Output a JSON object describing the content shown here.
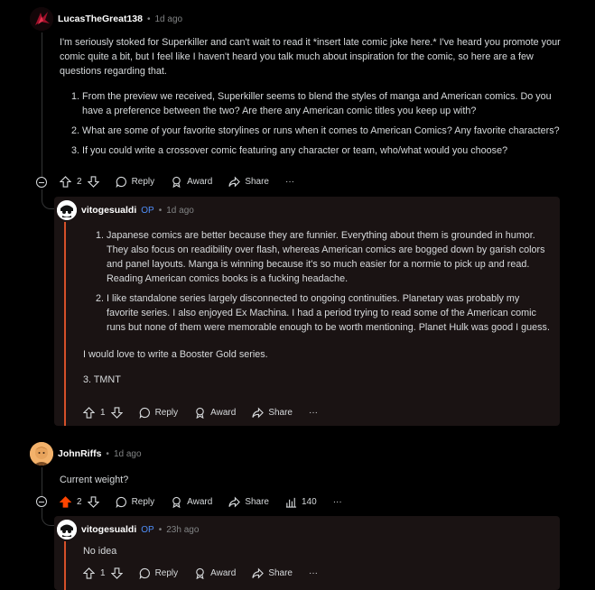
{
  "comment1": {
    "username": "LucasTheGreat138",
    "time": "1d ago",
    "intro": "I'm seriously stoked for Superkiller and can't wait to read it *insert late comic joke here.* I've heard you promote your comic quite a bit, but I feel like I haven't heard you talk much about inspiration for the comic, so here are a few questions regarding that.",
    "questions": [
      "From the preview we received, Superkiller seems to blend the styles of manga and American comics. Do you have a preference between the two? Are there any American comic titles you keep up with?",
      "What are some of your favorite storylines or runs when it comes to American Comics? Any favorite characters?",
      "If you could write a crossover comic featuring any character or team, who/what would you choose?"
    ],
    "score": "2",
    "reply_label": "Reply",
    "award_label": "Award",
    "share_label": "Share",
    "more_label": "···"
  },
  "reply1": {
    "username": "vitogesualdi",
    "op": "OP",
    "time": "1d ago",
    "answers": [
      "Japanese comics are better because they are funnier. Everything about them is grounded in humor. They also focus on readibility over flash, whereas American comics are bogged down by garish colors and panel layouts. Manga is winning because it's so much easier for a normie to pick up and read. Reading American comics books is a fucking headache.",
      "I like standalone series largely disconnected to ongoing continuities. Planetary was probably my favorite series. I also enjoyed Ex Machina. I had a period trying to read some of the American comic runs but none of them were memorable enough to be worth mentioning. Planet Hulk was good I guess."
    ],
    "para1": "I would love to write a Booster Gold series.",
    "para2": "3. TMNT",
    "score": "1",
    "reply_label": "Reply",
    "award_label": "Award",
    "share_label": "Share",
    "more_label": "···"
  },
  "comment2": {
    "username": "JohnRiffs",
    "time": "1d ago",
    "text": "Current weight?",
    "score": "2",
    "reply_label": "Reply",
    "award_label": "Award",
    "share_label": "Share",
    "views": "140",
    "more_label": "···"
  },
  "reply2": {
    "username": "vitogesualdi",
    "op": "OP",
    "time": "23h ago",
    "text": "No idea",
    "score": "1",
    "reply_label": "Reply",
    "award_label": "Award",
    "share_label": "Share",
    "more_label": "···"
  },
  "separator": "•",
  "colors": {
    "upvoted": "#ff4500",
    "op": "#4f8ef7",
    "reply_bar": "#d4502a"
  }
}
